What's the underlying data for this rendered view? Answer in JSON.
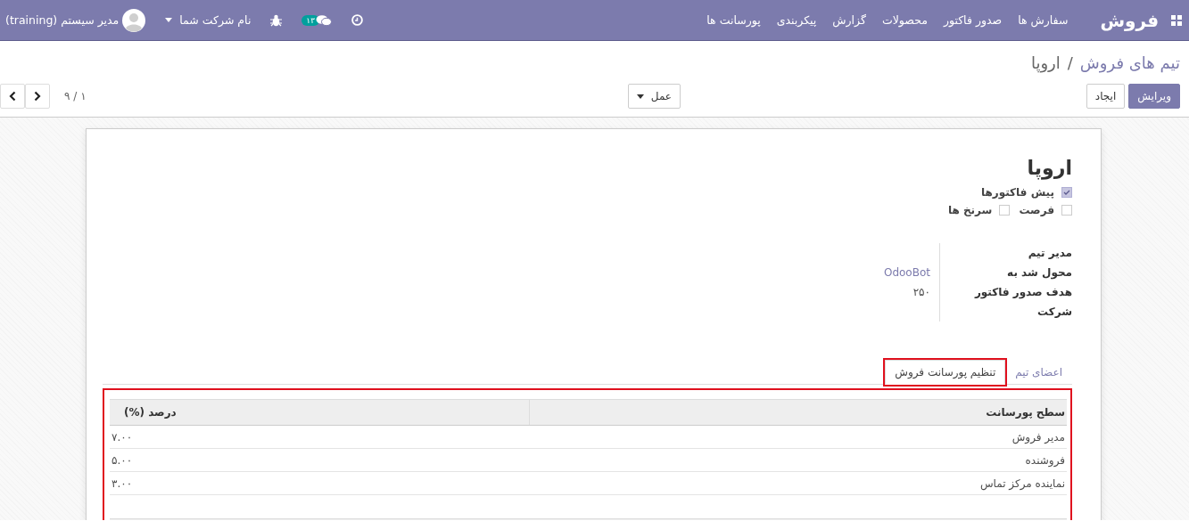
{
  "navbar": {
    "app_title": "فروش",
    "menu": [
      "سفارش ها",
      "صدور فاکتور",
      "محصولات",
      "گزارش",
      "پیکربندی",
      "پورسانت ها"
    ],
    "messages_badge": "۱۳",
    "company": "نام شرکت شما",
    "user": "مدیر سیستم (training)"
  },
  "breadcrumb": [
    {
      "label": "تیم های فروش",
      "kind": "link"
    },
    {
      "label": "/",
      "kind": "separator"
    },
    {
      "label": "اروپا",
      "kind": "current"
    }
  ],
  "buttons": [
    {
      "label": "ویرایش",
      "kind": "primary"
    },
    {
      "label": "ایجاد",
      "kind": "secondary"
    }
  ],
  "action_menu": "عمل",
  "pager": "۱ / ۹",
  "record": {
    "title": "اروپا",
    "options": [
      {
        "label": "پیش فاکتورها",
        "checked": true
      },
      {
        "label": "فرصت",
        "checked": false
      },
      {
        "label": "سرنخ ها",
        "checked": false
      }
    ],
    "fields": [
      {
        "label": "مدیر تیم"
      },
      {
        "label": "محول شد به",
        "value": "OdooBot",
        "kind": "link"
      },
      {
        "label": "هدف صدور فاکتور",
        "value": "۲۵۰",
        "kind": "text"
      },
      {
        "label": "شرکت"
      }
    ],
    "tabs": [
      {
        "label": "اعضای تیم",
        "selected": false,
        "highlighted": false
      },
      {
        "label": "تنظیم پورسانت فروش",
        "selected": true,
        "highlighted": true
      }
    ],
    "table": {
      "highlighted": true,
      "columns": [
        "سطح پورسانت",
        "درصد (%)"
      ],
      "rows": [
        [
          "مدیر فروش",
          "۷.۰۰"
        ],
        [
          "فروشنده",
          "۵.۰۰"
        ],
        [
          "نماینده مرکز تماس",
          "۳.۰۰"
        ]
      ]
    }
  }
}
